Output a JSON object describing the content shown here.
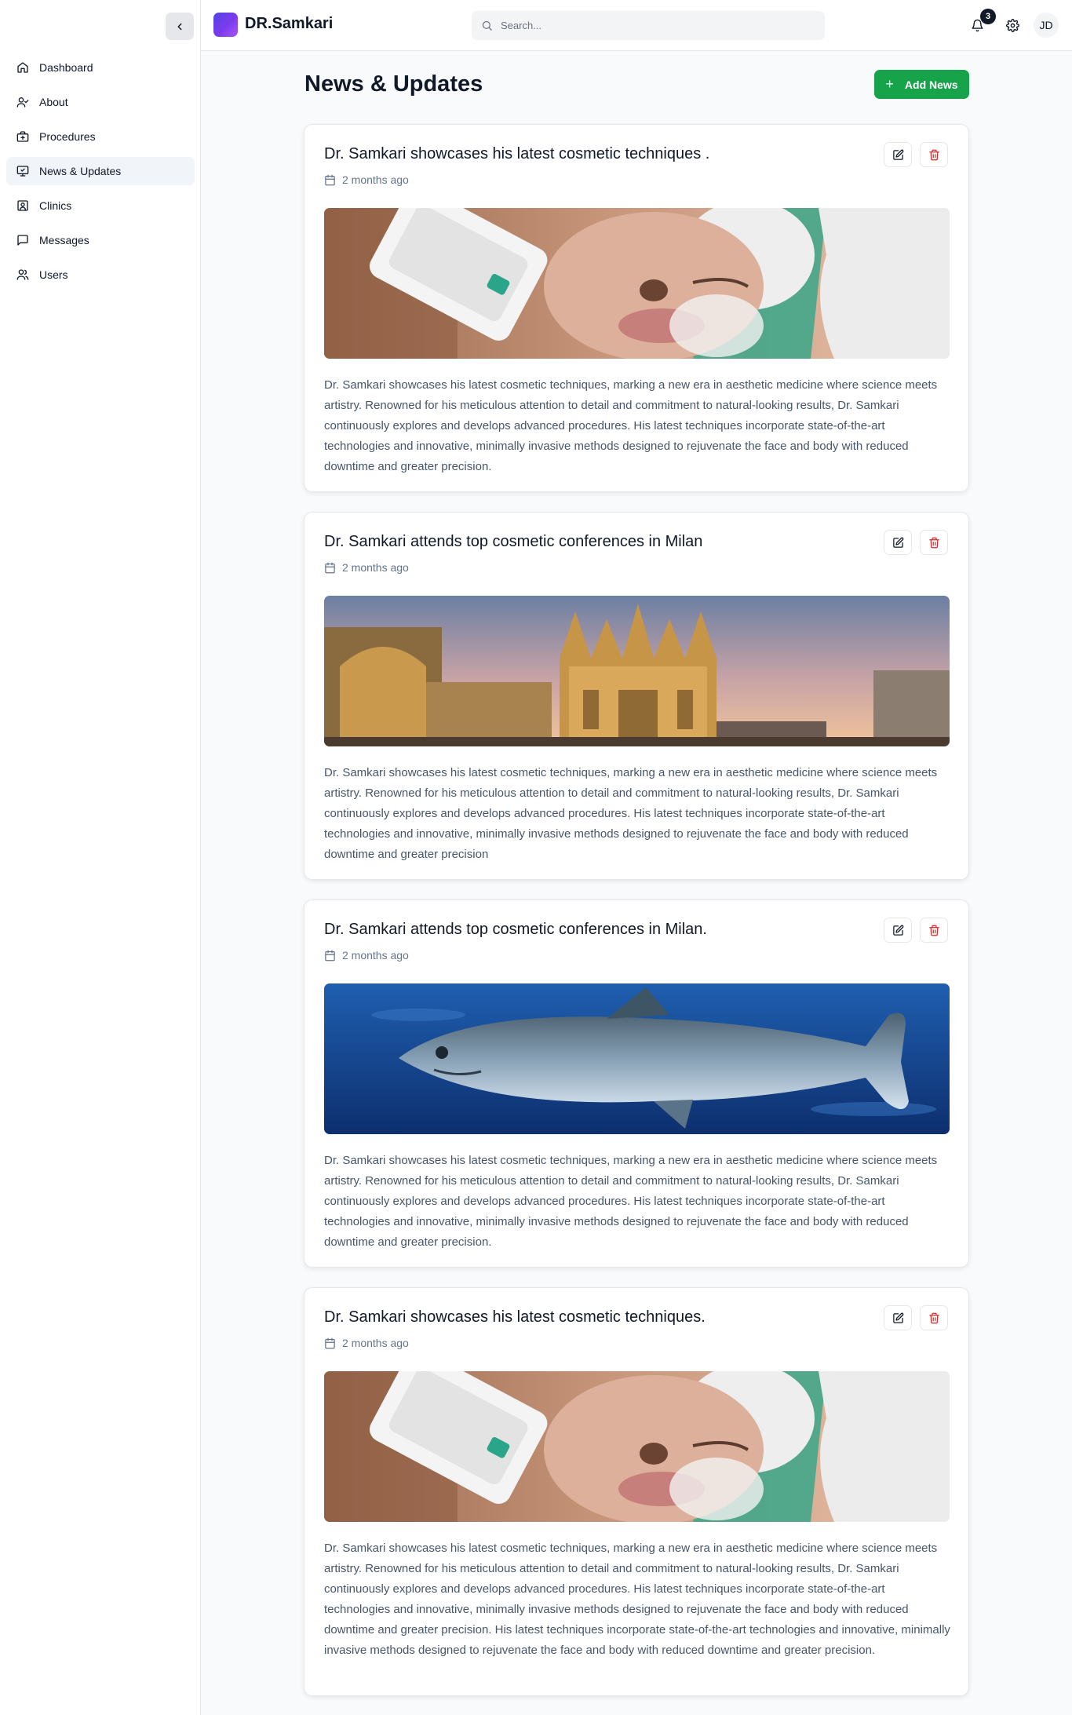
{
  "app": {
    "brand": "DR.Samkari"
  },
  "sidebar": {
    "items": [
      {
        "label": "Dashboard",
        "icon": "home-icon",
        "active": false
      },
      {
        "label": "About",
        "icon": "user-check-icon",
        "active": false
      },
      {
        "label": "Procedures",
        "icon": "briefcase-medical-icon",
        "active": false
      },
      {
        "label": "News & Updates",
        "icon": "monitor-icon",
        "active": true
      },
      {
        "label": "Clinics",
        "icon": "contact-icon",
        "active": false
      },
      {
        "label": "Messages",
        "icon": "message-square-icon",
        "active": false
      },
      {
        "label": "Users",
        "icon": "users-icon",
        "active": false
      }
    ]
  },
  "header": {
    "search_placeholder": "Search...",
    "notification_count": "3",
    "avatar_initials": "JD"
  },
  "main": {
    "title": "News & Updates",
    "add_button_label": "Add News",
    "accent_color": "#16a34a",
    "danger_color": "#dc2626",
    "news": [
      {
        "title": "Dr. Samkari showcases his latest cosmetic techniques .",
        "date": "2 months ago",
        "image": "cosmetic-treatment-photo",
        "body": "Dr. Samkari showcases his latest cosmetic techniques, marking a new era in aesthetic medicine where science meets artistry. Renowned for his meticulous attention to detail and commitment to natural-looking results, Dr. Samkari continuously explores and develops advanced procedures. His latest techniques incorporate state-of-the-art technologies and innovative, minimally invasive methods designed to rejuvenate the face and body with reduced downtime and greater precision."
      },
      {
        "title": "Dr. Samkari attends top cosmetic conferences in Milan",
        "date": "2 months ago",
        "image": "milan-cathedral-photo",
        "body": "Dr. Samkari showcases his latest cosmetic techniques, marking a new era in aesthetic medicine where science meets artistry. Renowned for his meticulous attention to detail and commitment to natural-looking results, Dr. Samkari continuously explores and develops advanced procedures. His latest techniques incorporate state-of-the-art technologies and innovative, minimally invasive methods designed to rejuvenate the face and body with reduced downtime and greater precision"
      },
      {
        "title": "Dr. Samkari attends top cosmetic conferences in Milan.",
        "date": "2 months ago",
        "image": "salmon-fish-photo",
        "body": "Dr. Samkari showcases his latest cosmetic techniques, marking a new era in aesthetic medicine where science meets artistry. Renowned for his meticulous attention to detail and commitment to natural-looking results, Dr. Samkari continuously explores and develops advanced procedures. His latest techniques incorporate state-of-the-art technologies and innovative, minimally invasive methods designed to rejuvenate the face and body with reduced downtime and greater precision."
      },
      {
        "title": "Dr. Samkari showcases his latest cosmetic techniques.",
        "date": "2 months ago",
        "image": "cosmetic-treatment-photo",
        "body": "Dr. Samkari showcases his latest cosmetic techniques, marking a new era in aesthetic medicine where science meets artistry. Renowned for his meticulous attention to detail and commitment to natural-looking results, Dr. Samkari continuously explores and develops advanced procedures. His latest techniques incorporate state-of-the-art technologies and innovative, minimally invasive methods designed to rejuvenate the face and body with reduced downtime and greater precision. His latest techniques incorporate state-of-the-art technologies and innovative, minimally invasive methods designed to rejuvenate the face and body with reduced downtime and greater precision."
      }
    ]
  }
}
